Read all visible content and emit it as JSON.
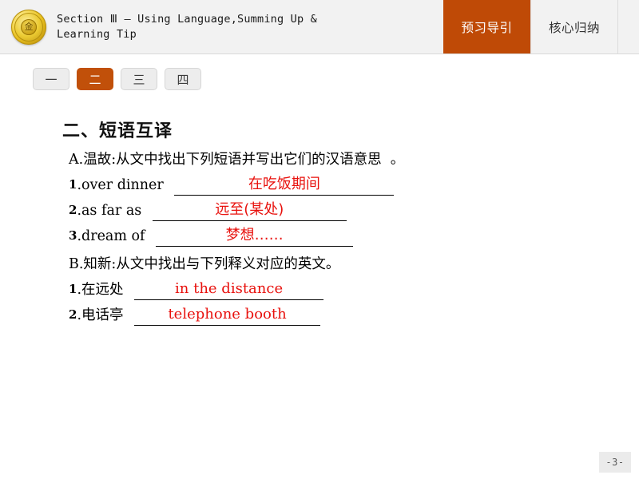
{
  "header": {
    "logo_icon": "gold-medallion-icon",
    "logo_glyph": "金",
    "title": "Section Ⅲ — Using Language,Summing Up &\nLearning Tip",
    "tabs": [
      {
        "label": "预习导引",
        "active": true
      },
      {
        "label": "核心归纳",
        "active": false
      }
    ],
    "accent_color": "#bf4a06",
    "background_color": "#f2f2f2"
  },
  "subtabs": [
    {
      "label": "一",
      "active": false
    },
    {
      "label": "二",
      "active": true
    },
    {
      "label": "三",
      "active": false
    },
    {
      "label": "四",
      "active": false
    }
  ],
  "main": {
    "section_title": "二、短语互译",
    "part_a": {
      "prompt": "A.温故:从文中找出下列短语并写出它们的汉语意思  。",
      "items": [
        {
          "num": "1",
          "label": ".over dinner ",
          "answer": "在吃饭期间"
        },
        {
          "num": "2",
          "label": ".as far as ",
          "answer": "远至(某处)"
        },
        {
          "num": "3",
          "label": ".dream of ",
          "answer": "梦想……"
        }
      ]
    },
    "part_b": {
      "prompt": "B.知新:从文中找出与下列释义对应的英文。",
      "items": [
        {
          "num": "1",
          "label": ".在远处 ",
          "answer": "in the distance"
        },
        {
          "num": "2",
          "label": ".电话亭 ",
          "answer": "telephone booth"
        }
      ]
    },
    "answer_color": "#e8110d"
  },
  "footer": {
    "page_number": "-3-"
  }
}
